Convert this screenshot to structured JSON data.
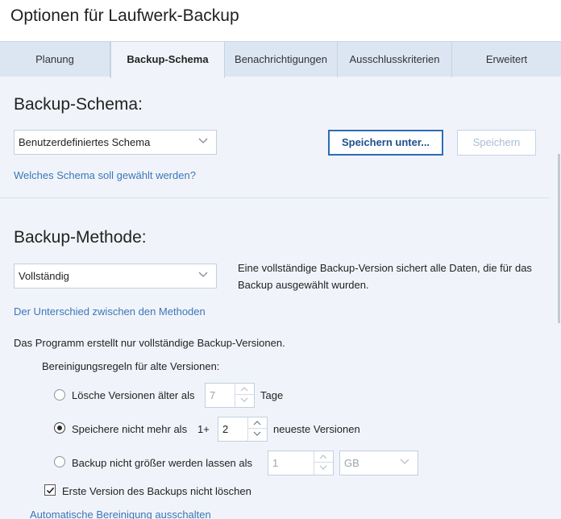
{
  "window": {
    "title": "Optionen für Laufwerk-Backup"
  },
  "tabs": [
    {
      "label": "Planung",
      "active": false
    },
    {
      "label": "Backup-Schema",
      "active": true
    },
    {
      "label": "Benachrichtigungen",
      "active": false
    },
    {
      "label": "Ausschlusskriterien",
      "active": false
    },
    {
      "label": "Erweitert",
      "active": false
    }
  ],
  "schema": {
    "heading": "Backup-Schema:",
    "select_value": "Benutzerdefiniertes Schema",
    "save_as_label": "Speichern unter...",
    "save_label": "Speichern",
    "help_link": "Welches Schema soll gewählt werden?"
  },
  "method": {
    "heading": "Backup-Methode:",
    "select_value": "Vollständig",
    "description": "Eine vollständige Backup-Version sichert alle Daten, die für das Backup ausgewählt wurden.",
    "diff_link": "Der Unterschied zwischen den Methoden",
    "info": "Das Programm erstellt nur vollständige Backup-Versionen."
  },
  "cleanup": {
    "heading": "Bereinigungsregeln für alte Versionen:",
    "option1": {
      "label": "Lösche Versionen älter als",
      "value": "7",
      "unit": "Tage",
      "selected": false
    },
    "option2": {
      "label": "Speichere nicht mehr als",
      "prefix": "1+",
      "value": "2",
      "unit": "neueste Versionen",
      "selected": true
    },
    "option3": {
      "label": "Backup nicht größer werden lassen als",
      "value": "1",
      "unit": "GB",
      "selected": false
    },
    "keep_first": {
      "label": "Erste Version des Backups nicht löschen",
      "checked": true
    },
    "disable_link": "Automatische Bereinigung ausschalten"
  },
  "colors": {
    "accent": "#2e6bb8",
    "link": "#3d76b8",
    "background": "#f0f4fa",
    "tabbar": "#dce6f2"
  }
}
